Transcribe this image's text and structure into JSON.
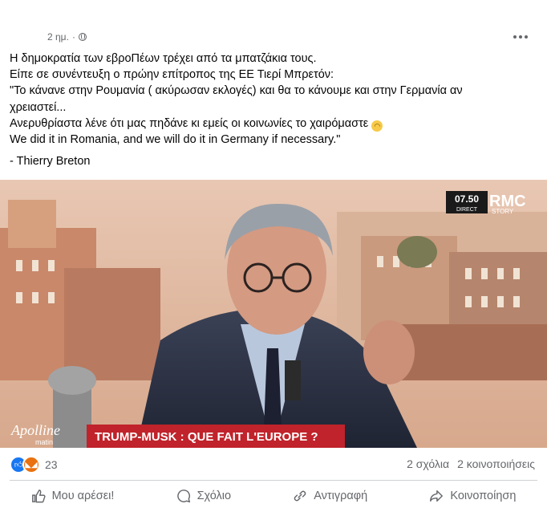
{
  "post": {
    "timestamp": "2 ημ.",
    "separator": "·",
    "privacy_icon": "globe-icon",
    "more_icon": "more-horizontal-icon",
    "lines": [
      "Η δημοκρατία των εβροΠέων τρέχει από τα μπατζάκια τους.",
      "Είπε σε συνέντευξη ο πρώην επίτροπος της ΕΕ Τιερί Μπρετόν:",
      "\"Το κάνανε στην Ρουμανία ( ακύρωσαν εκλογές) και θα το κάνουμε και στην Γερμανία αν",
      "χρειαστεί...",
      "Ανερυθρίαστα λένε ότι μας πηδάνε κι εμείς οι κοινωνίες το χαιρόμαστε",
      "We did it in Romania, and we will do it in Germany if necessary.\""
    ],
    "signature": "- Thierry Breton",
    "emoji_icon": "sad-face-emoji"
  },
  "video": {
    "channel_time": "07.50",
    "channel_direct": "DIRECT",
    "channel_name": "RMC",
    "channel_sub": "STORY",
    "show_name": "Apolline",
    "show_sub": "matin",
    "banner": "TRUMP-MUSK : QUE FAIT L'EUROPE ?"
  },
  "stats": {
    "reaction_icons": [
      "like-icon",
      "angry-icon"
    ],
    "reaction_count": "23",
    "comments": "2 σχόλια",
    "shares": "2 κοινοποιήσεις"
  },
  "actions": {
    "like": "Μου αρέσει!",
    "comment": "Σχόλιο",
    "copy": "Αντιγραφή",
    "share": "Κοινοποίηση"
  },
  "colors": {
    "accent": "#1877f2",
    "angry": "#e9710f",
    "muted": "#65676b",
    "banner_red": "#c0232b"
  }
}
